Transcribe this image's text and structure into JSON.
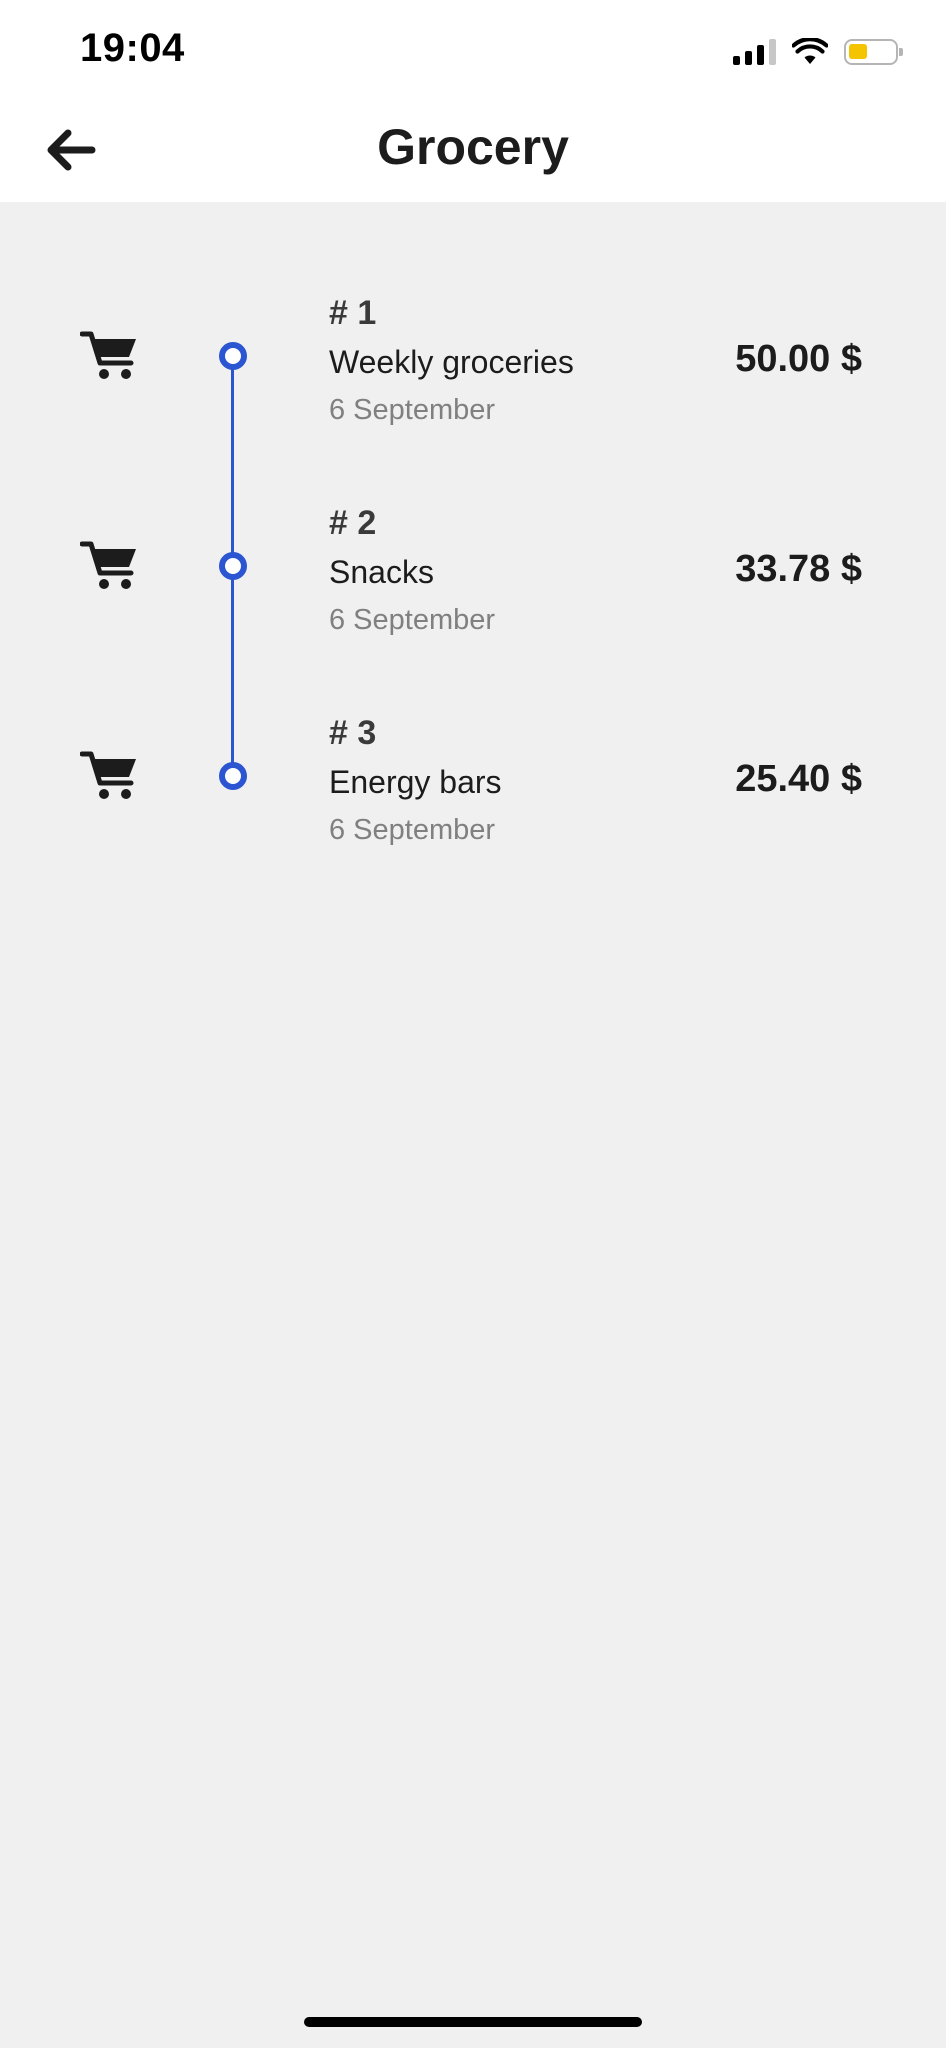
{
  "status_bar": {
    "time": "19:04",
    "battery_color": "#f5c400"
  },
  "header": {
    "title": "Grocery",
    "back_icon": "arrow-left-icon"
  },
  "colors": {
    "timeline_accent": "#2b55d1",
    "background": "#f0f0f0",
    "header_background": "#ffffff"
  },
  "transactions": [
    {
      "number": "# 1",
      "title": "Weekly groceries",
      "date": "6 September",
      "amount": "50.00 $",
      "icon": "shopping-cart-icon"
    },
    {
      "number": "# 2",
      "title": "Snacks",
      "date": "6 September",
      "amount": "33.78 $",
      "icon": "shopping-cart-icon"
    },
    {
      "number": "# 3",
      "title": "Energy bars",
      "date": "6 September",
      "amount": "25.40 $",
      "icon": "shopping-cart-icon"
    }
  ]
}
